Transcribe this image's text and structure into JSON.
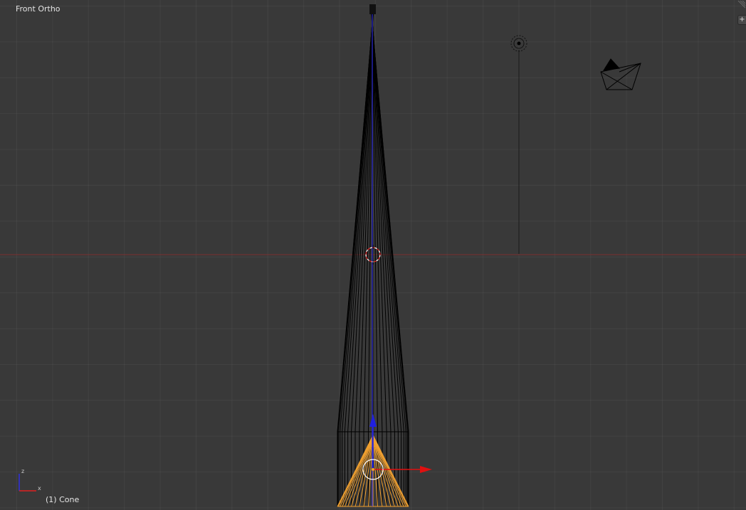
{
  "viewport": {
    "view_name": "Front Ortho",
    "active_object": "(1) Cone",
    "add_button_symbol": "+",
    "colors": {
      "background": "#393939",
      "grid": "#454545",
      "x_axis": "#8b2f2f",
      "wireframe": "#000000",
      "selected": "#f0a030",
      "manipulator_x": "#e01010",
      "manipulator_z": "#2020e0"
    },
    "icons": {
      "axis_gizmo": "xyz-axis-icon",
      "lamp": "lamp-icon",
      "camera": "camera-icon",
      "cursor": "3d-cursor-icon",
      "add": "plus-icon"
    }
  }
}
